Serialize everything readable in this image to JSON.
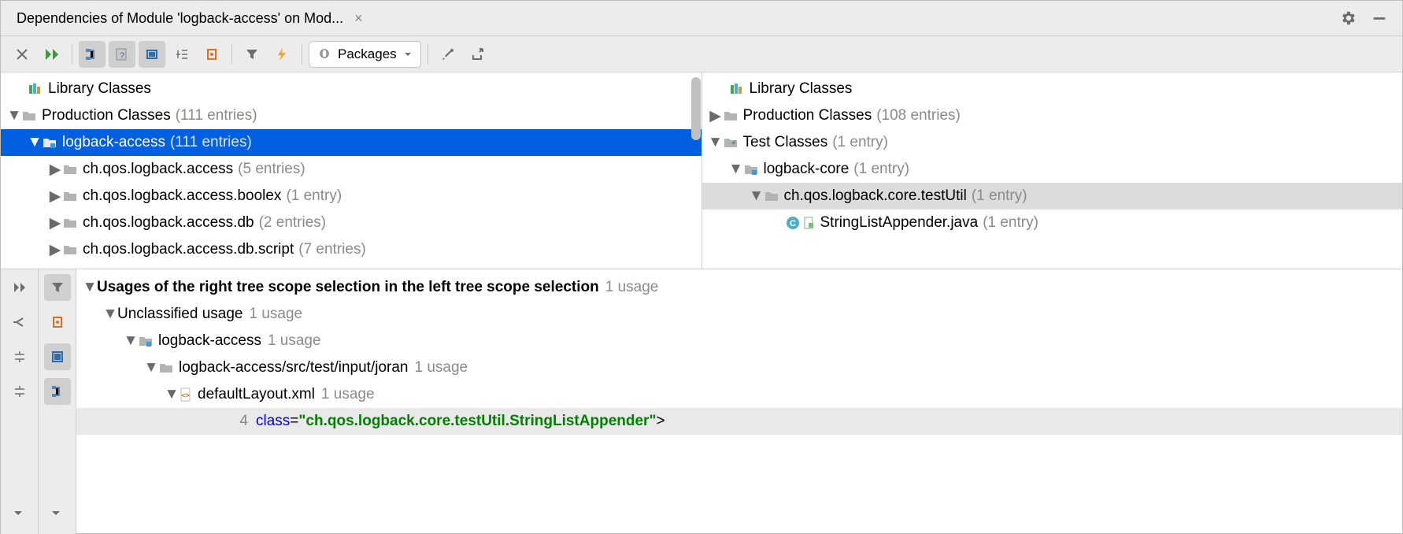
{
  "title": "Dependencies of Module 'logback-access' on Mod...",
  "dropdown": "Packages",
  "left": {
    "library": "Library Classes",
    "production": {
      "label": "Production Classes",
      "entries": "(111 entries)"
    },
    "module": {
      "label": "logback-access",
      "entries": "(111 entries)"
    },
    "pkgs": [
      {
        "label": "ch.qos.logback.access",
        "entries": "(5 entries)"
      },
      {
        "label": "ch.qos.logback.access.boolex",
        "entries": "(1 entry)"
      },
      {
        "label": "ch.qos.logback.access.db",
        "entries": "(2 entries)"
      },
      {
        "label": "ch.qos.logback.access.db.script",
        "entries": "(7 entries)"
      }
    ]
  },
  "right": {
    "library": "Library Classes",
    "production": {
      "label": "Production Classes",
      "entries": "(108 entries)"
    },
    "test": {
      "label": "Test Classes",
      "entries": "(1 entry)"
    },
    "module": {
      "label": "logback-core",
      "entries": "(1 entry)"
    },
    "pkg": {
      "label": "ch.qos.logback.core.testUtil",
      "entries": "(1 entry)"
    },
    "file": {
      "label": "StringListAppender.java",
      "entries": "(1 entry)"
    }
  },
  "usages": {
    "heading": "Usages of the right tree scope selection in the left tree scope selection",
    "heading_entries": "1 usage",
    "unclassified": {
      "label": "Unclassified usage",
      "entries": "1 usage"
    },
    "module": {
      "label": "logback-access",
      "entries": "1 usage"
    },
    "dir": {
      "label": "logback-access/src/test/input/joran",
      "entries": "1 usage"
    },
    "file": {
      "label": "defaultLayout.xml",
      "entries": "1 usage"
    },
    "line": {
      "num": "4",
      "attr": "class",
      "eq": "=",
      "q1": "\"",
      "val": "ch.qos.logback.core.testUtil.StringListAppender",
      "q2": "\"",
      "gt": ">"
    }
  }
}
